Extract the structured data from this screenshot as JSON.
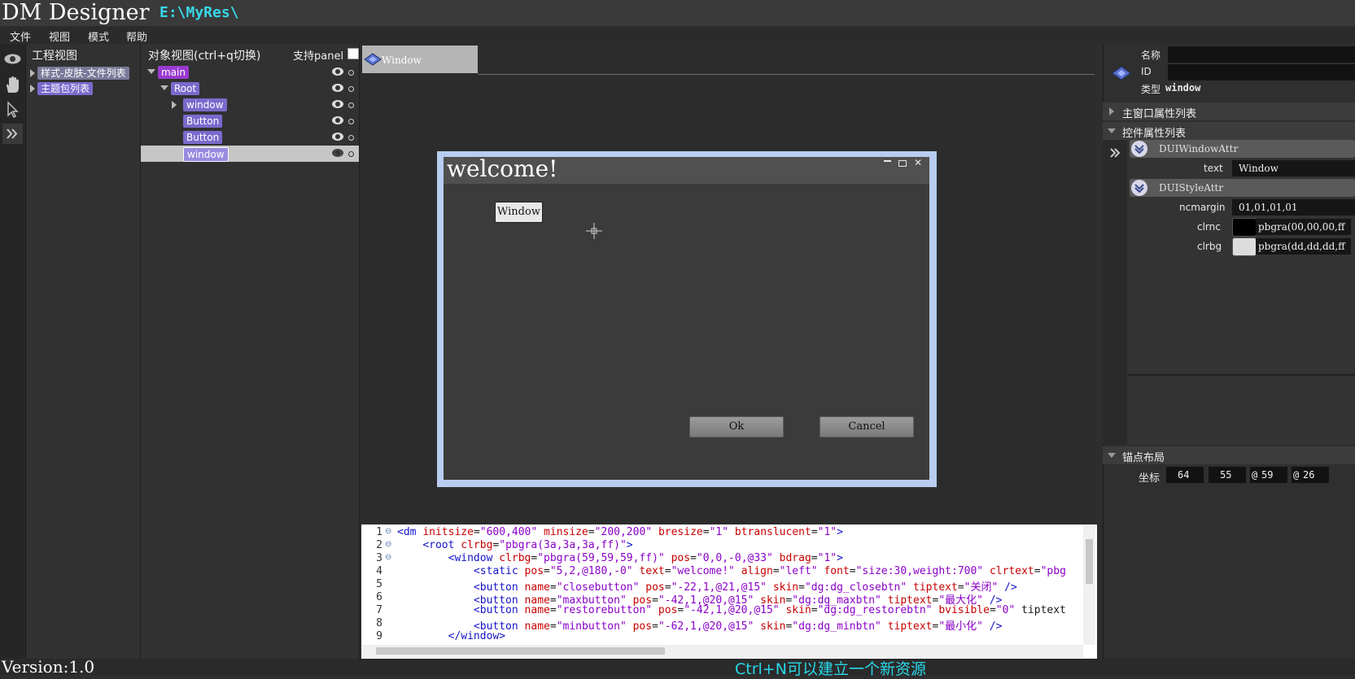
{
  "app": {
    "title": "DM Designer",
    "path": "E:\\MyRes\\"
  },
  "menu": [
    "文件",
    "视图",
    "模式",
    "帮助"
  ],
  "toolbar": [
    "eye-icon",
    "hand-icon",
    "pointer-icon",
    "expand-icon"
  ],
  "project_view": {
    "title": "工程视图",
    "items": [
      "样式-皮肤-文件列表",
      "主题包列表"
    ]
  },
  "object_view": {
    "title": "对象视图(ctrl+q切换)",
    "support_panel": "支持panel",
    "items": [
      "main",
      "Root",
      "window",
      "Button",
      "Button",
      "window"
    ]
  },
  "canvas": {
    "tab": "Window",
    "design": {
      "title": "welcome!",
      "window_button": "Window",
      "ok_button": "Ok",
      "cancel_button": "Cancel"
    }
  },
  "code": {
    "line_numbers": [
      "1",
      "2",
      "3",
      "4",
      "5",
      "6",
      "7",
      "8",
      "9"
    ],
    "lines": [
      "<dm initsize=\"600,400\" minsize=\"200,200\" bresize=\"1\" btranslucent=\"1\">",
      "    <root clrbg=\"pbgra(3a,3a,3a,ff)\">",
      "        <window clrbg=\"pbgra(59,59,59,ff)\" pos=\"0,0,-0,@33\" bdrag=\"1\">",
      "            <static pos=\"5,2,@180,-0\" text=\"welcome!\" align=\"left\" font=\"size:30,weight:700\" clrtext=\"pbg",
      "            <button name=\"closebutton\" pos=\"-22,1,@21,@15\" skin=\"dg:dg_closebtn\" tiptext=\"关闭\" />",
      "            <button name=\"maxbutton\" pos=\"-42,1,@20,@15\" skin=\"dg:dg_maxbtn\" tiptext=\"最大化\" />",
      "            <button name=\"restorebutton\" pos=\"-42,1,@20,@15\" skin=\"dg:dg_restorebtn\" bvisible=\"0\" tiptext",
      "            <button name=\"minbutton\" pos=\"-62,1,@20,@15\" skin=\"dg:dg_minbtn\" tiptext=\"最小化\" />",
      "        </window>"
    ]
  },
  "properties": {
    "name_label": "名称",
    "id_label": "ID",
    "type_label": "类型",
    "type_value": "window",
    "main_window_section": "主窗口属性列表",
    "control_section": "控件属性列表",
    "window_attr_group": "DUIWindowAttr",
    "text_label": "text",
    "text_value": "Window",
    "style_attr_group": "DUIStyleAttr",
    "ncmargin_label": "ncmargin",
    "ncmargin_value": "01,01,01,01",
    "clrnc_label": "clrnc",
    "clrnc_value": "pbgra(00,00,00,ff",
    "clrnc_color": "#000000",
    "clrbg_label": "clrbg",
    "clrbg_value": "pbgra(dd,dd,dd,ff",
    "clrbg_color": "#dddddd",
    "anchor_section": "锚点布局",
    "coord_label": "坐标",
    "coords": [
      "64",
      "55",
      "59",
      "26"
    ],
    "coord_prefixes": [
      "",
      "",
      "@",
      "@"
    ]
  },
  "status": {
    "version": "Version:1.0",
    "hint": "Ctrl+N可以建立一个新资源"
  }
}
